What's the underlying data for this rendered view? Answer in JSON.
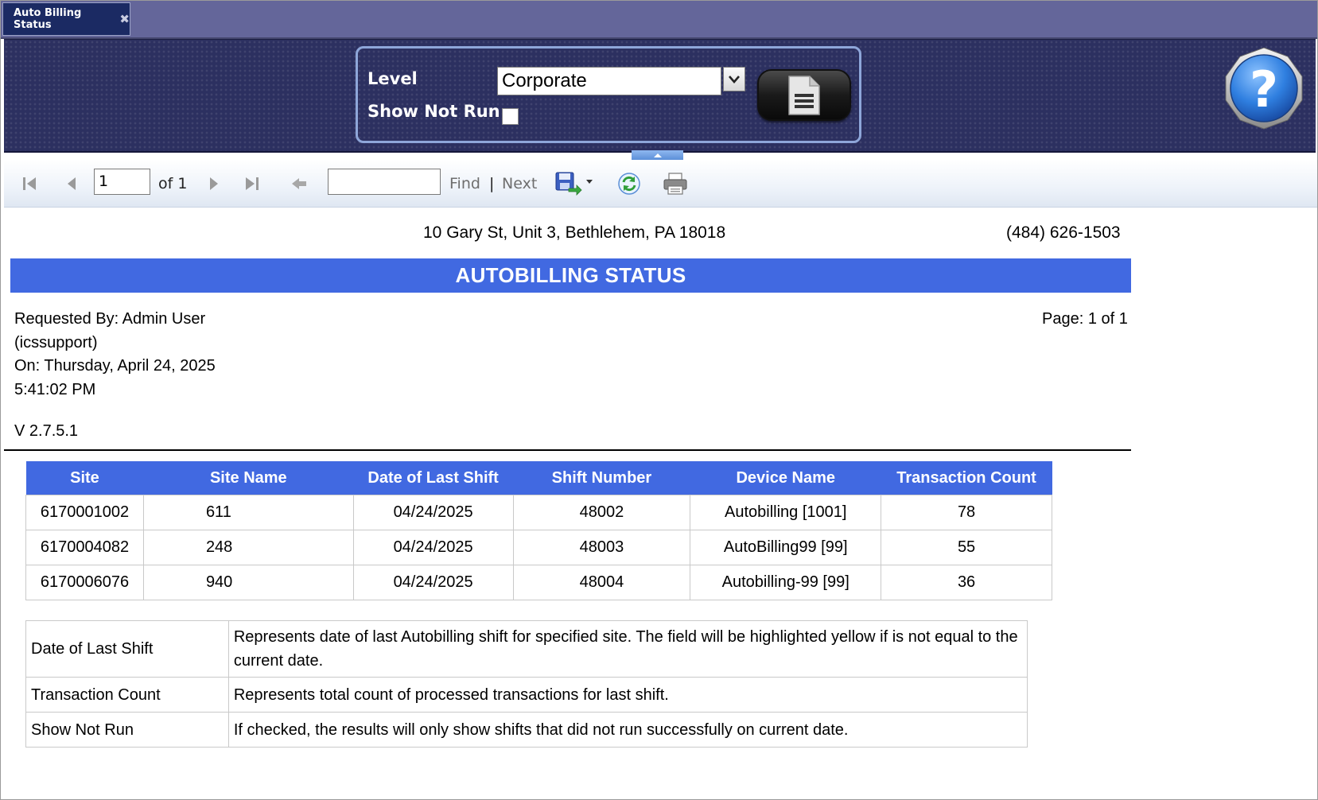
{
  "tab": {
    "label": "Auto Billing Status",
    "close_glyph": "✖"
  },
  "parameters": {
    "level_label": "Level",
    "level_value": "Corporate",
    "show_not_run_label": "Show Not Run",
    "show_not_run_checked": false
  },
  "toolbar": {
    "current_page": "1",
    "of_label": "of 1",
    "find_label": "Find",
    "separator": "|",
    "next_label": "Next",
    "find_value": ""
  },
  "report": {
    "address": "10 Gary St, Unit 3, Bethlehem, PA 18018",
    "phone": "(484) 626-1503",
    "title": "AUTOBILLING STATUS",
    "requested_by": "Requested By: Admin User",
    "requested_by_login": "(icssupport)",
    "on_date": "On: Thursday, April 24, 2025",
    "on_time": "5:41:02 PM",
    "page_info": "Page: 1 of 1",
    "version": "V 2.7.5.1"
  },
  "table": {
    "columns": [
      "Site",
      "Site Name",
      "Date of Last Shift",
      "Shift Number",
      "Device Name",
      "Transaction Count"
    ],
    "rows": [
      [
        "6170001002",
        "611",
        "04/24/2025",
        "48002",
        "Autobilling [1001]",
        "78"
      ],
      [
        "6170004082",
        "248",
        "04/24/2025",
        "48003",
        "AutoBilling99 [99]",
        "55"
      ],
      [
        "6170006076",
        "940",
        "04/24/2025",
        "48004",
        "Autobilling-99 [99]",
        "36"
      ]
    ]
  },
  "legend": [
    {
      "term": "Date of Last Shift",
      "description": "Represents date of last Autobilling shift for specified site.  The field will be highlighted yellow if is not equal to the current date."
    },
    {
      "term": "Transaction Count",
      "description": "Represents total count of processed transactions for last shift."
    },
    {
      "term": "Show Not Run",
      "description": "If checked, the results will only show shifts that did not run successfully on current date."
    }
  ],
  "colors": {
    "banner": "#4169e1",
    "panel": "#2c3060",
    "tabstrip": "#64669a"
  },
  "icons": [
    "close-icon",
    "chevron-down-icon",
    "report-document-icon",
    "help-icon",
    "first-page-icon",
    "previous-page-icon",
    "next-page-icon",
    "last-page-icon",
    "back-icon",
    "export-save-icon",
    "refresh-icon",
    "print-icon"
  ]
}
